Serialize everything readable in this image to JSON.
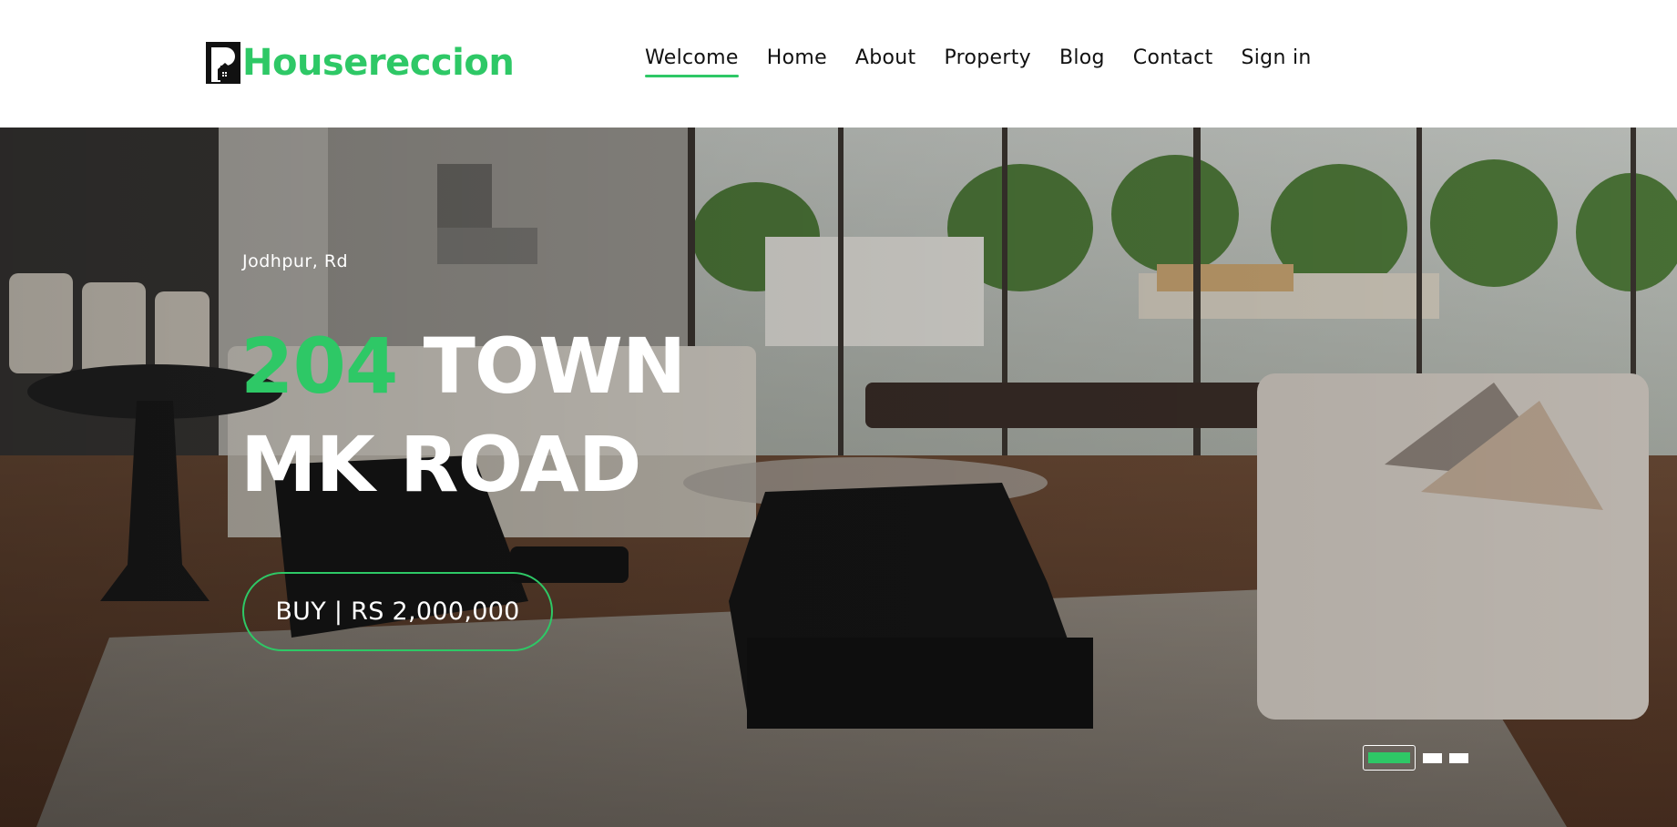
{
  "colors": {
    "accent": "#2ec866",
    "text_dark": "#111111",
    "hero_text": "#ffffff"
  },
  "brand": {
    "name": "Housereccion",
    "logo_icon": "house-logo-icon"
  },
  "nav": {
    "items": [
      {
        "label": "Welcome",
        "active": true
      },
      {
        "label": "Home"
      },
      {
        "label": "About"
      },
      {
        "label": "Property"
      },
      {
        "label": "Blog"
      },
      {
        "label": "Contact"
      },
      {
        "label": "Sign in"
      }
    ]
  },
  "hero": {
    "location": "Jodhpur, Rd",
    "title_number": "204",
    "title_rest_line1": "TOWN",
    "title_line2": "MK ROAD",
    "price_button": "BUY | RS 2,000,000",
    "slides": {
      "count": 3,
      "active_index": 0
    }
  }
}
